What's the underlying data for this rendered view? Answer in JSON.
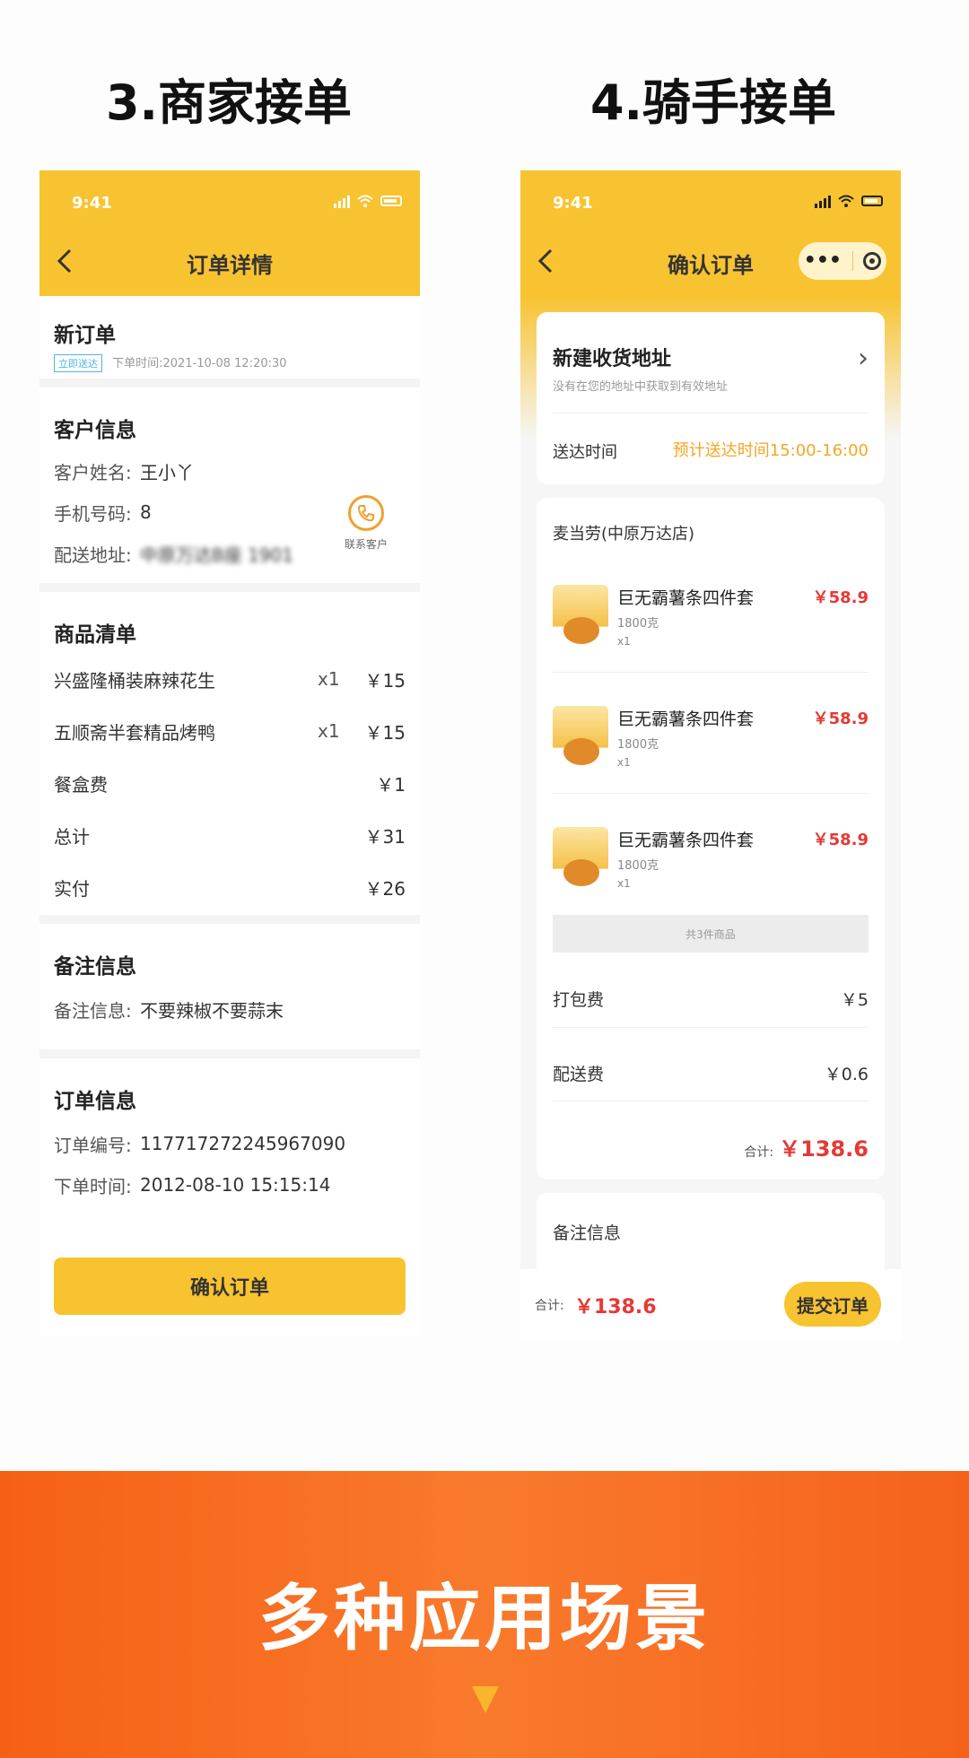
{
  "titles": {
    "left": "3.商家接单",
    "right": "4.骑手接单"
  },
  "merchant": {
    "status_time": "9:41",
    "nav_title": "订单详情",
    "new_order": {
      "title": "新订单",
      "badge": "立即送达",
      "order_time": "下单时间:2021-10-08 12:20:30"
    },
    "customer": {
      "title": "客户信息",
      "name_label": "客户姓名:",
      "name_value": "王小丫",
      "phone_label": "手机号码:",
      "phone_value": "8",
      "address_label": "配送地址:",
      "address_value": "中原万达B座 1901",
      "contact_label": "联系客户"
    },
    "goods": {
      "title": "商品清单",
      "items": [
        {
          "name": "兴盛隆桶装麻辣花生",
          "qty": "x1",
          "price": "￥15"
        },
        {
          "name": "五顺斋半套精品烤鸭",
          "qty": "x1",
          "price": "￥15"
        },
        {
          "name": "餐盒费",
          "qty": "",
          "price": "￥1"
        },
        {
          "name": "总计",
          "qty": "",
          "price": "￥31"
        },
        {
          "name": "实付",
          "qty": "",
          "price": "￥26"
        }
      ]
    },
    "remark": {
      "title": "备注信息",
      "label": "备注信息:",
      "value": "不要辣椒不要蒜末"
    },
    "order_info": {
      "title": "订单信息",
      "no_label": "订单编号:",
      "no_value": "117717272245967090",
      "time_label": "下单时间:",
      "time_value": "2012-08-10 15:15:14"
    },
    "confirm_label": "确认订单"
  },
  "rider": {
    "status_time": "9:41",
    "nav_title": "确认订单",
    "address": {
      "main": "新建收货地址",
      "sub": "没有在您的地址中获取到有效地址",
      "delivery_label": "送达时间",
      "delivery_value": "预计送达时间15:00-16:00"
    },
    "shop_name": "麦当劳(中原万达店)",
    "products": [
      {
        "name": "巨无霸薯条四件套",
        "weight": "1800克",
        "qty": "x1",
        "price": "￥58.9"
      },
      {
        "name": "巨无霸薯条四件套",
        "weight": "1800克",
        "qty": "x1",
        "price": "￥58.9"
      },
      {
        "name": "巨无霸薯条四件套",
        "weight": "1800克",
        "qty": "x1",
        "price": "￥58.9"
      }
    ],
    "count_text": "共3件商品",
    "packing_label": "打包费",
    "packing_value": "￥5",
    "delivery_fee_label": "配送费",
    "delivery_fee_value": "￥0.6",
    "total_label": "合计:",
    "total_value": "￥138.6",
    "remark_title": "备注信息",
    "bottom_total_label": "合计:",
    "bottom_total_value": "￥138.6",
    "submit_label": "提交订单"
  },
  "banner": {
    "text": "多种应用场景"
  },
  "colors": {
    "accent_yellow": "#f8c330",
    "price_red": "#e53935",
    "banner_orange": "#f66016"
  },
  "icons": [
    "signal-icon",
    "wifi-icon",
    "battery-icon",
    "back-icon",
    "more-icon",
    "record-icon",
    "phone-icon",
    "chevron-right-icon",
    "down-arrow-icon"
  ]
}
